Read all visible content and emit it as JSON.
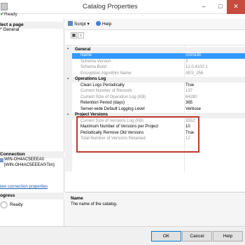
{
  "window": {
    "title": "Catalog Properties",
    "ready_text": "Ready",
    "minimize_glyph": "–",
    "maximize_glyph": "□",
    "close_glyph": "✕"
  },
  "left_pane": {
    "select_page_header": "lect a page",
    "pages": [
      "* General"
    ],
    "connection_header": "Connection",
    "connection_server": "WIN-OH4AC5EEEA0",
    "connection_user": "[WIN-OH4AC5EEEA0\\Tim]",
    "view_connection_link": "iew connection properties",
    "progress_header": "ogress",
    "progress_status": "Ready"
  },
  "toolbar": {
    "script_label": "Script",
    "script_dropdown_glyph": "▾",
    "help_label": "Help"
  },
  "property_grid": {
    "rows": [
      {
        "type": "category",
        "label": "General",
        "expanded": true
      },
      {
        "type": "prop",
        "label": "Name",
        "value": "SSISDB",
        "selected": true,
        "disabled": false
      },
      {
        "type": "prop",
        "label": "Schema Version",
        "value": "3",
        "disabled": true
      },
      {
        "type": "prop",
        "label": "Schema Build",
        "value": "12.0.4100.1",
        "disabled": true
      },
      {
        "type": "prop",
        "label": "Encryption Algorithm Name",
        "value": "AES_256",
        "disabled": true
      },
      {
        "type": "category",
        "label": "Operations Log",
        "expanded": true
      },
      {
        "type": "prop",
        "label": "Clean Logs Periodically",
        "value": "True",
        "disabled": false
      },
      {
        "type": "prop",
        "label": "Current Number of Records",
        "value": "137",
        "disabled": true
      },
      {
        "type": "prop",
        "label": "Current Size of Operation Log (KB)",
        "value": "64280",
        "disabled": true
      },
      {
        "type": "prop",
        "label": "Retention Period (days)",
        "value": "365",
        "disabled": false
      },
      {
        "type": "prop",
        "label": "Server-wide Default Logging Level",
        "value": "Verbose",
        "disabled": false
      },
      {
        "type": "category",
        "label": "Project Versions",
        "expanded": true
      },
      {
        "type": "prop",
        "label": "Current Size of Versions Log (KB)",
        "value": "3552",
        "disabled": true
      },
      {
        "type": "prop",
        "label": "Maximum Number of Versions per Project",
        "value": "10",
        "disabled": false
      },
      {
        "type": "prop",
        "label": "Periodically Remove Old Versions",
        "value": "True",
        "disabled": false
      },
      {
        "type": "prop",
        "label": "Total Number of Versions Retained",
        "value": "12",
        "disabled": true
      }
    ]
  },
  "description": {
    "heading": "Name",
    "text": "The name of the catalog."
  },
  "buttons": {
    "ok": "OK",
    "cancel": "Cancel",
    "help": "Help"
  },
  "colors": {
    "selection": "#3399ff",
    "highlight_box": "#c0392b",
    "close_button": "#c74b3f"
  }
}
